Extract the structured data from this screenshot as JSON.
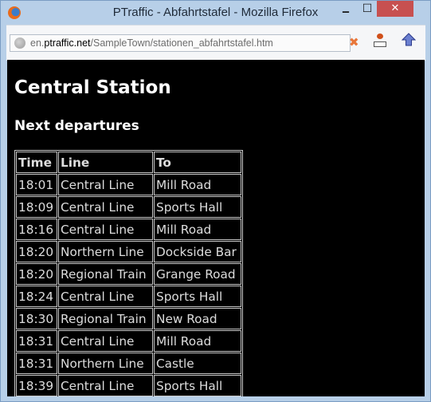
{
  "window": {
    "title": "PTraffic - Abfahrtstafel - Mozilla Firefox",
    "controls": {
      "minimize": "‒",
      "maximize": "☐",
      "close": "✕"
    }
  },
  "toolbar": {
    "url_domain_prefix": "en.",
    "url_domain": "ptraffic.net",
    "url_path": "/SampleTown/stationen_abfahrtstafel.htm",
    "stop_glyph": "✖"
  },
  "page": {
    "heading": "Central Station",
    "subheading": "Next departures",
    "table": {
      "headers": [
        "Time",
        "Line",
        "To"
      ],
      "rows": [
        [
          "18:01",
          "Central Line",
          "Mill Road"
        ],
        [
          "18:09",
          "Central Line",
          "Sports Hall"
        ],
        [
          "18:16",
          "Central Line",
          "Mill Road"
        ],
        [
          "18:20",
          "Northern Line",
          "Dockside Bar"
        ],
        [
          "18:20",
          "Regional Train",
          "Grange Road"
        ],
        [
          "18:24",
          "Central Line",
          "Sports Hall"
        ],
        [
          "18:30",
          "Regional Train",
          "New Road"
        ],
        [
          "18:31",
          "Central Line",
          "Mill Road"
        ],
        [
          "18:31",
          "Northern Line",
          "Castle"
        ],
        [
          "18:39",
          "Central Line",
          "Sports Hall"
        ]
      ]
    }
  }
}
